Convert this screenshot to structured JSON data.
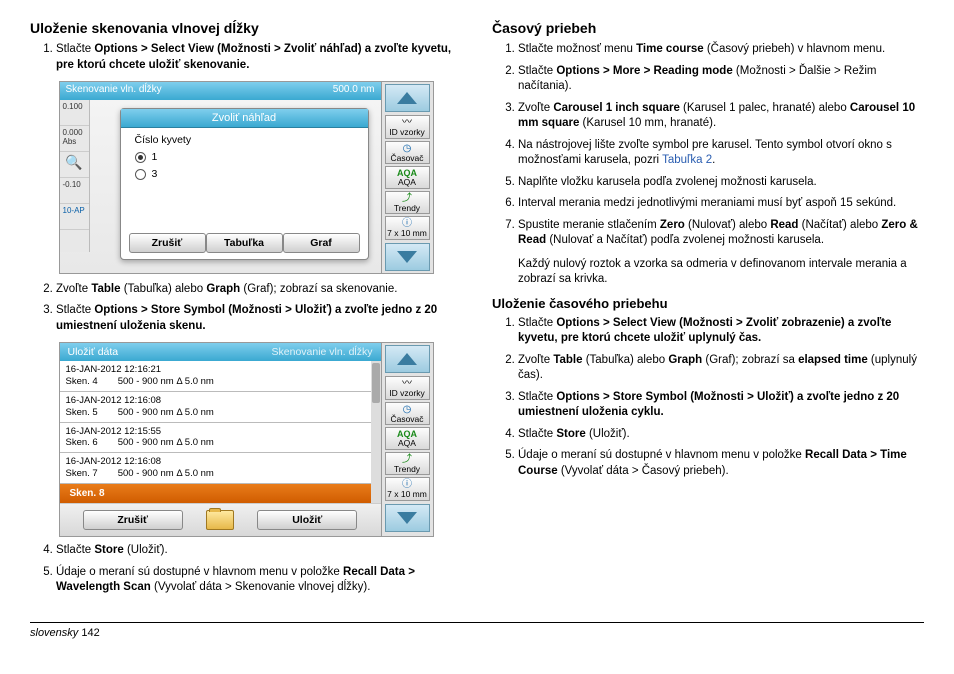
{
  "left": {
    "h1": "Uloženie skenovania vlnovej dĺžky",
    "ol1": [
      "Stlačte <b>Options > Select View (Možnosti > Zvoliť náhľad) a zvoľte kyvetu, pre ktorú chcete uložiť skenovanie.</b>"
    ],
    "ol1b": [
      "Zvoľte <b>Table</b> (Tabuľka) alebo <b>Graph</b> (Graf); zobrazí sa skenovanie.",
      "Stlačte <b>Options > Store Symbol (Možnosti > Uložiť) a zvoľte jedno z 20 umiestnení uloženia skenu.</b>"
    ],
    "ol1c": [
      "Stlačte <b>Store</b> (Uložiť).",
      "Údaje o meraní sú dostupné v hlavnom menu v položke <b>Recall Data > Wavelength Scan</b> (Vyvolať dáta > Skenovanie vlnovej dĺžky)."
    ],
    "ss1": {
      "topLeft": "Skenovanie vln. dĺžky",
      "topRight": "500.0 nm",
      "dlgTitle": "Zvoliť náhľad",
      "label": "Číslo kyvety",
      "opt1": "1",
      "opt3": "3",
      "btnCancel": "Zrušiť",
      "btnTable": "Tabuľka",
      "btnGraph": "Graf",
      "l1": "0.100",
      "l2": "0.000",
      "l2b": "Abs",
      "l4": "-0.10",
      "l5": "10-AP"
    },
    "ss2": {
      "title": "Uložiť dáta",
      "titleRight": "Skenovanie vln. dĺžky",
      "entries": [
        {
          "d": "16-JAN-2012  12:16:21",
          "s": "Sken. 4",
          "r": "500 - 900 nm Δ 5.0 nm"
        },
        {
          "d": "16-JAN-2012  12:16:08",
          "s": "Sken. 5",
          "r": "500 - 900 nm Δ 5.0 nm"
        },
        {
          "d": "16-JAN-2012  12:15:55",
          "s": "Sken. 6",
          "r": "500 - 900 nm Δ 5.0 nm"
        },
        {
          "d": "16-JAN-2012  12:16:08",
          "s": "Sken. 7",
          "r": "500 - 900 nm Δ 5.0 nm"
        }
      ],
      "selected": "Sken. 8",
      "btnCancel": "Zrušiť",
      "btnSave": "Uložiť"
    },
    "side": {
      "id": "ID vzorky",
      "timer": "Časovač",
      "aqa": "AQA",
      "trendy": "Trendy",
      "cuvette": "7 x 10 mm"
    }
  },
  "right": {
    "h1": "Časový priebeh",
    "ol1": [
      "Stlačte možnosť menu <b>Time course</b> (Časový priebeh) v hlavnom menu.",
      "Stlačte <b>Options > More > Reading mode</b> (Možnosti > Ďalšie > Režim načítania).",
      "Zvoľte <b>Carousel 1 inch square</b> (Karusel 1 palec, hranaté) alebo <b>Carousel 10 mm square</b> (Karusel 10 mm, hranaté).",
      "Na nástrojovej lište zvoľte symbol pre karusel. Tento symbol otvorí okno s možnosťami karusela, pozri <span class=\"link\">Tabuľka 2</span>.",
      "Naplňte vložku karusela podľa zvolenej možnosti karusela.",
      "Interval merania medzi jednotlivými meraniami musí byť aspoň 15 sekúnd.",
      "Spustite meranie stlačením <b>Zero</b> (Nulovať) alebo <b>Read</b> (Načítať) alebo <b>Zero & Read</b> (Nulovať a Načítať) podľa zvolenej možnosti karusela."
    ],
    "note": "Každý nulový roztok a vzorka sa odmeria v definovanom intervale merania a zobrazí sa krivka.",
    "h2": "Uloženie časového priebehu",
    "ol2": [
      "Stlačte <b>Options > Select View (Možnosti > Zvoliť zobrazenie) a zvoľte kyvetu, pre ktorú chcete uložiť uplynulý čas.</b>",
      "Zvoľte <b>Table</b> (Tabuľka) alebo <b>Graph</b> (Graf); zobrazí sa <b>elapsed time</b> (uplynulý čas).",
      "Stlačte <b>Options > Store Symbol (Možnosti > Uložiť) a zvoľte jedno z 20 umiestnení uloženia cyklu.</b>",
      "Stlačte <b>Store</b> (Uložiť).",
      "Údaje o meraní sú dostupné v hlavnom menu v položke <b>Recall Data > Time Course</b> (Vyvolať dáta > Časový priebeh)."
    ]
  },
  "footer": {
    "lang": "slovensky",
    "page": "142"
  }
}
